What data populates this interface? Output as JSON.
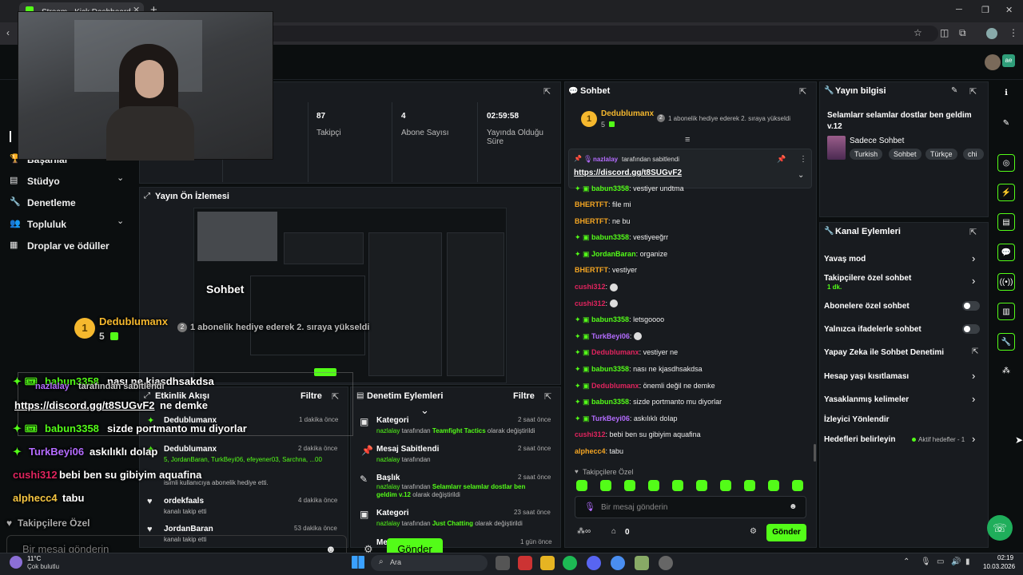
{
  "browser": {
    "tab_title": "Stream - Kick Dashboard",
    "tab_close": "✕",
    "new_tab": "+"
  },
  "sidebar": {
    "items": [
      {
        "label": "Başarılar",
        "icon": "trophy-icon"
      },
      {
        "label": "Stüdyo",
        "icon": "studio-icon",
        "chevron": "⌄"
      },
      {
        "label": "Denetleme",
        "icon": "wrench-icon"
      },
      {
        "label": "Topluluk",
        "icon": "community-icon",
        "chevron": "⌄"
      },
      {
        "label": "Droplar ve ödüller",
        "icon": "grid-icon"
      }
    ]
  },
  "stats": [
    {
      "value": "87",
      "label": "Takipçi"
    },
    {
      "value": "4",
      "label": "Abone Sayısı"
    },
    {
      "value": "02:59:58",
      "label": "Yayında Olduğu Süre"
    }
  ],
  "preview": {
    "title": "Yayın Ön İzlemesi"
  },
  "overlay": {
    "chat_title": "Sohbet",
    "top_user": "Dedublumanx",
    "top_rank": "1",
    "top_count": "5",
    "top_gift_text": "1 abonelik hediye ederek 2. sıraya yükseldi",
    "pinned_by": "nazlalay",
    "pinned_text": "tarafından sabitlendi",
    "pinned_link": "https://discord.gg/t8SUGvF2",
    "ne_demke": "ne demke",
    "messages": [
      {
        "user": "babun3358",
        "text": "nası ne kjasdhsakdsa",
        "color": "#53fc18",
        "badge": true
      },
      {
        "user": "babun3358",
        "text": "sizde portmanto mu diyorlar",
        "color": "#53fc18",
        "badge": true
      },
      {
        "user": "TurkBeyi06",
        "text": "askılıklı dolap",
        "color": "#b46cff",
        "badge": true
      },
      {
        "user": "cushi312",
        "text": "bebi ben su gibiyim aquafina",
        "color": "#e0245e",
        "badge": false
      },
      {
        "user": "alphecc4",
        "text": "tabu",
        "color": "#f5c542",
        "badge": false
      }
    ],
    "followers_only": "Takipçilere Özel",
    "send_placeholder": "Bir mesaj gönderin",
    "send_button": "Gönder",
    "weather_temp": "11°C",
    "weather_desc": "Çok bulutlu"
  },
  "activity": {
    "title": "Etkinlik Akışı",
    "filter": "Filtre",
    "events": [
      {
        "title": "Dedublumanx",
        "time": "1 dakika önce",
        "sub": "",
        "subgreen": ""
      },
      {
        "title": "Dedublumanx",
        "time": "2 dakika önce",
        "subgreen": "5, JordanBaran, TurkBeyi06, efeyener03, Sarchna, ...00",
        "sub": "isimli kullanıcıya abonelik hediye etti."
      },
      {
        "title": "ordekfaals",
        "time": "4 dakika önce",
        "sub": "kanalı takip etti",
        "subgreen": ""
      },
      {
        "title": "JordanBaran",
        "time": "53 dakika önce",
        "sub": "kanalı takip etti",
        "subgreen": ""
      }
    ]
  },
  "moderation": {
    "title": "Denetim Eylemleri",
    "filter": "Filtre",
    "events": [
      {
        "title": "Kategori",
        "time": "2 saat önce",
        "user": "nazlalay",
        "pre": "tarafından",
        "value": "Teamfight Tactics",
        "post": "olarak değiştirildi"
      },
      {
        "title": "Mesaj Sabitlendi",
        "time": "2 saat önce",
        "user": "nazlalay",
        "pre": "tarafından",
        "value": "",
        "post": ""
      },
      {
        "title": "Başlık",
        "time": "2 saat önce",
        "user": "nazlalay",
        "pre": "tarafından",
        "value": "Selamlarr selamlar dostlar ben geldim v.12",
        "post": "olarak değiştirildi"
      },
      {
        "title": "Kategori",
        "time": "23 saat önce",
        "user": "nazlalay",
        "pre": "tarafından",
        "value": "Just Chatting",
        "post": "olarak değiştirildi"
      },
      {
        "title": "Me",
        "time": "1 gün önce",
        "user": "",
        "pre": "",
        "value": "",
        "post": ""
      }
    ]
  },
  "chat": {
    "title": "Sohbet",
    "top_user": "Dedublumanx",
    "top_rank": "1",
    "top_count": "5",
    "top_gift_text": "1 abonelik hediye ederek 2. sıraya yükseldi",
    "pinned_by": "nazlalay",
    "pinned_text": "tarafından sabitlendi",
    "pinned_link": "https://discord.gg/t8SUGvF2",
    "messages": [
      {
        "user": "babun3358",
        "text": "vestiyer undtma",
        "color": "#53fc18",
        "badge": true
      },
      {
        "user": "BHERTFT",
        "text": "file mi",
        "color": "#f5a623",
        "badge": false
      },
      {
        "user": "BHERTFT",
        "text": "ne bu",
        "color": "#f5a623",
        "badge": false
      },
      {
        "user": "babun3358",
        "text": "vestiyeeğrr",
        "color": "#53fc18",
        "badge": true
      },
      {
        "user": "JordanBaran",
        "text": "organize",
        "color": "#53fc18",
        "badge": true
      },
      {
        "user": "BHERTFT",
        "text": "vestiyer",
        "color": "#f5a623",
        "badge": false
      },
      {
        "user": "cushi312",
        "text": "",
        "color": "#e0245e",
        "badge": false
      },
      {
        "user": "cushi312",
        "text": "",
        "color": "#e0245e",
        "badge": false
      },
      {
        "user": "babun3358",
        "text": "letsgoooo",
        "color": "#53fc18",
        "badge": true
      },
      {
        "user": "TurkBeyi06",
        "text": "",
        "color": "#b46cff",
        "badge": true
      },
      {
        "user": "Dedublumanx",
        "text": "vestiyer ne",
        "color": "#e0245e",
        "badge": true
      },
      {
        "user": "babun3358",
        "text": "nası ne kjasdhsakdsa",
        "color": "#53fc18",
        "badge": true
      },
      {
        "user": "Dedublumanx",
        "text": "önemli değil ne demke",
        "color": "#e0245e",
        "badge": true
      },
      {
        "user": "babun3358",
        "text": "sizde portmanto mu diyorlar",
        "color": "#53fc18",
        "badge": true
      },
      {
        "user": "TurkBeyi06",
        "text": "askılıklı dolap",
        "color": "#b46cff",
        "badge": true
      },
      {
        "user": "cushi312",
        "text": "bebi ben su gibiyim aquafina",
        "color": "#e0245e",
        "badge": false
      },
      {
        "user": "alphecc4",
        "text": "tabu",
        "color": "#f5a623",
        "badge": false
      }
    ],
    "followers_only": "Takipçilere Özel",
    "send_placeholder": "Bir mesaj gönderin",
    "points": "0",
    "send_button": "Gönder"
  },
  "stream_info": {
    "title": "Yayın bilgisi",
    "stream_title": "Selamlarr selamlar dostlar ben geldim v.12",
    "category": "Sadece Sohbet",
    "tags": [
      "Turkish",
      "Sohbet",
      "Türkçe",
      "chi"
    ]
  },
  "channel_actions": {
    "title": "Kanal Eylemleri",
    "items": [
      {
        "label": "Yavaş mod",
        "control": "chevron",
        "sub": ""
      },
      {
        "label": "Takipçilere özel sohbet",
        "control": "chevron",
        "sub": "1 dk."
      },
      {
        "label": "Abonelere özel sohbet",
        "control": "toggle",
        "sub": ""
      },
      {
        "label": "Yalnızca ifadelerle sohbet",
        "control": "toggle",
        "sub": ""
      },
      {
        "label": "Yapay Zeka ile Sohbet Denetimi",
        "control": "external",
        "sub": ""
      },
      {
        "label": "Hesap yaşı kısıtlaması",
        "control": "chevron",
        "sub": ""
      },
      {
        "label": "Yasaklanmış kelimeler",
        "control": "chevron",
        "sub": ""
      },
      {
        "label": "İzleyici Yönlendir",
        "control": "none",
        "sub": ""
      },
      {
        "label": "Hedefleri belirleyin",
        "control": "chevron",
        "sub": "Aktif hedefler - 1"
      }
    ]
  },
  "taskbar": {
    "search": "Ara",
    "time": "02:19",
    "date": "10.03.2026"
  },
  "colors": {
    "accent": "#53fc18",
    "panel": "#181b1f",
    "background": "#0b0e0f"
  }
}
